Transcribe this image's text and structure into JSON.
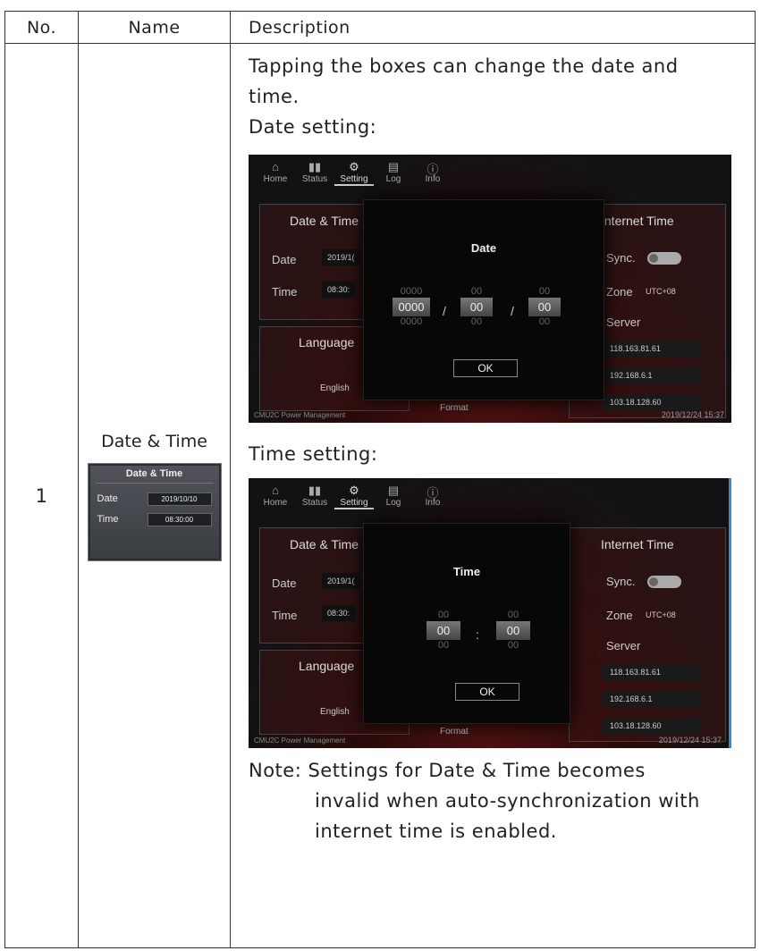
{
  "table": {
    "headers": {
      "no": "No.",
      "name": "Name",
      "description": "Description"
    },
    "row": {
      "no": "1",
      "name": "Date & Time",
      "intro_line1": "Tapping the boxes can change the date and",
      "intro_line2": "time.",
      "date_heading": "Date setting:",
      "time_heading": "Time setting:",
      "note_line1": "Note: Settings for Date & Time becomes",
      "note_line2": "invalid when auto-synchronization with",
      "note_line3": "internet time is enabled."
    }
  },
  "mini_widget": {
    "title": "Date & Time",
    "date_label": "Date",
    "date_value": "2019/10/10",
    "time_label": "Time",
    "time_value": "08:30:00"
  },
  "screen": {
    "nav": [
      {
        "label": "Home",
        "icon": "home-icon",
        "glyph": "⌂"
      },
      {
        "label": "Status",
        "icon": "bar-chart-icon",
        "glyph": "▮▮"
      },
      {
        "label": "Setting",
        "icon": "gear-icon",
        "glyph": "⚙"
      },
      {
        "label": "Log",
        "icon": "log-icon",
        "glyph": "▤"
      },
      {
        "label": "Info",
        "icon": "info-icon",
        "glyph": "ⓘ"
      }
    ],
    "date_time_title": "Date & Time",
    "date_label": "Date",
    "date_value": "2019/1(",
    "time_label": "Time",
    "time_value": "08:30:",
    "language_title": "Language",
    "language_value": "English",
    "format_label": "Format",
    "internet_time_title": "Internet Time",
    "sync_label": "Sync.",
    "zone_label": "Zone",
    "zone_value": "UTC+08",
    "server_label": "Server",
    "servers": [
      "118.163.81.61",
      "192.168.6.1",
      "103.18.128.60"
    ],
    "footer_left": "CMU2C Power Management",
    "footer_right": "2019/12/24 15:37"
  },
  "date_dialog": {
    "title": "Date",
    "year": {
      "prev": "0000",
      "cur": "0000",
      "next": "0000"
    },
    "month": {
      "prev": "00",
      "cur": "00",
      "next": "00"
    },
    "day": {
      "prev": "00",
      "cur": "00",
      "next": "00"
    },
    "separator": "/",
    "ok": "OK"
  },
  "time_dialog": {
    "title": "Time",
    "hour": {
      "prev": "00",
      "cur": "00",
      "next": "00"
    },
    "minute": {
      "prev": "00",
      "cur": "00",
      "next": "00"
    },
    "separator": ":",
    "ok": "OK"
  }
}
